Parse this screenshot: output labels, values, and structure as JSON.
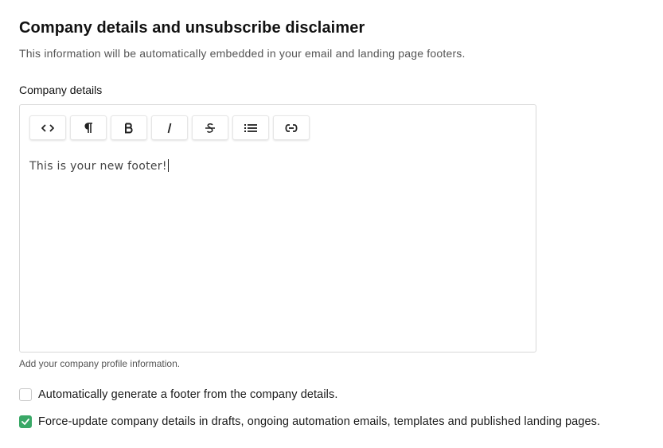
{
  "section": {
    "title": "Company details and unsubscribe disclaimer",
    "subtitle": "This information will be automatically embedded in your email and landing page footers."
  },
  "editor": {
    "label": "Company details",
    "content": "This is your new footer!",
    "helper": "Add your company profile information.",
    "toolbar": [
      {
        "name": "code-view-button",
        "icon": "code-icon"
      },
      {
        "name": "paragraph-button",
        "icon": "pilcrow-icon"
      },
      {
        "name": "bold-button",
        "icon": "bold-icon"
      },
      {
        "name": "italic-button",
        "icon": "italic-icon"
      },
      {
        "name": "strikethrough-button",
        "icon": "strikethrough-icon"
      },
      {
        "name": "bulleted-list-button",
        "icon": "list-icon"
      },
      {
        "name": "link-button",
        "icon": "link-icon"
      }
    ]
  },
  "options": {
    "auto_generate": {
      "label": "Automatically generate a footer from the company details.",
      "checked": false
    },
    "force_update": {
      "label": "Force-update company details in drafts, ongoing automation emails, templates and published landing pages.",
      "checked": true
    }
  },
  "colors": {
    "accent": "#3aa867",
    "border": "#d9d9d9"
  }
}
